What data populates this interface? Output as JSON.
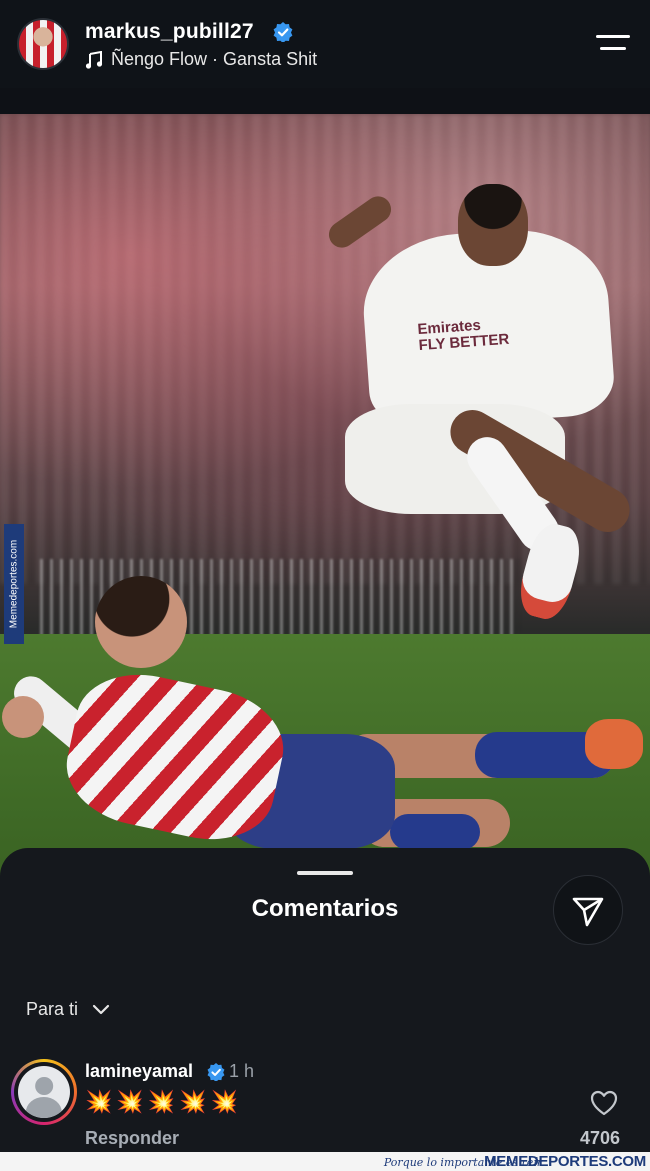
{
  "header": {
    "username": "markus_pubill27",
    "music": "Ñengo Flow · Gansta Shit"
  },
  "photo": {
    "side_watermark": "Memedeportes.com",
    "shirt_text_line1": "Emirates",
    "shirt_text_line2": "FLY BETTER"
  },
  "sheet": {
    "title": "Comentarios",
    "filter_label": "Para ti"
  },
  "comment": {
    "username": "lamineyamal",
    "time": "1 h",
    "text": "💥💥💥💥💥",
    "reply_label": "Responder",
    "likes": "4706"
  },
  "footer": {
    "tagline": "Porque lo importante es reír",
    "brand": "MEMEDEPORTES.COM"
  },
  "colors": {
    "background": "#0e1116",
    "verified": "#3897f0",
    "brand": "#1e3b7a"
  },
  "icons": [
    "verified-icon",
    "music-note-icon",
    "menu-icon",
    "share-send-icon",
    "chevron-down-icon",
    "heart-icon",
    "default-avatar-icon"
  ]
}
